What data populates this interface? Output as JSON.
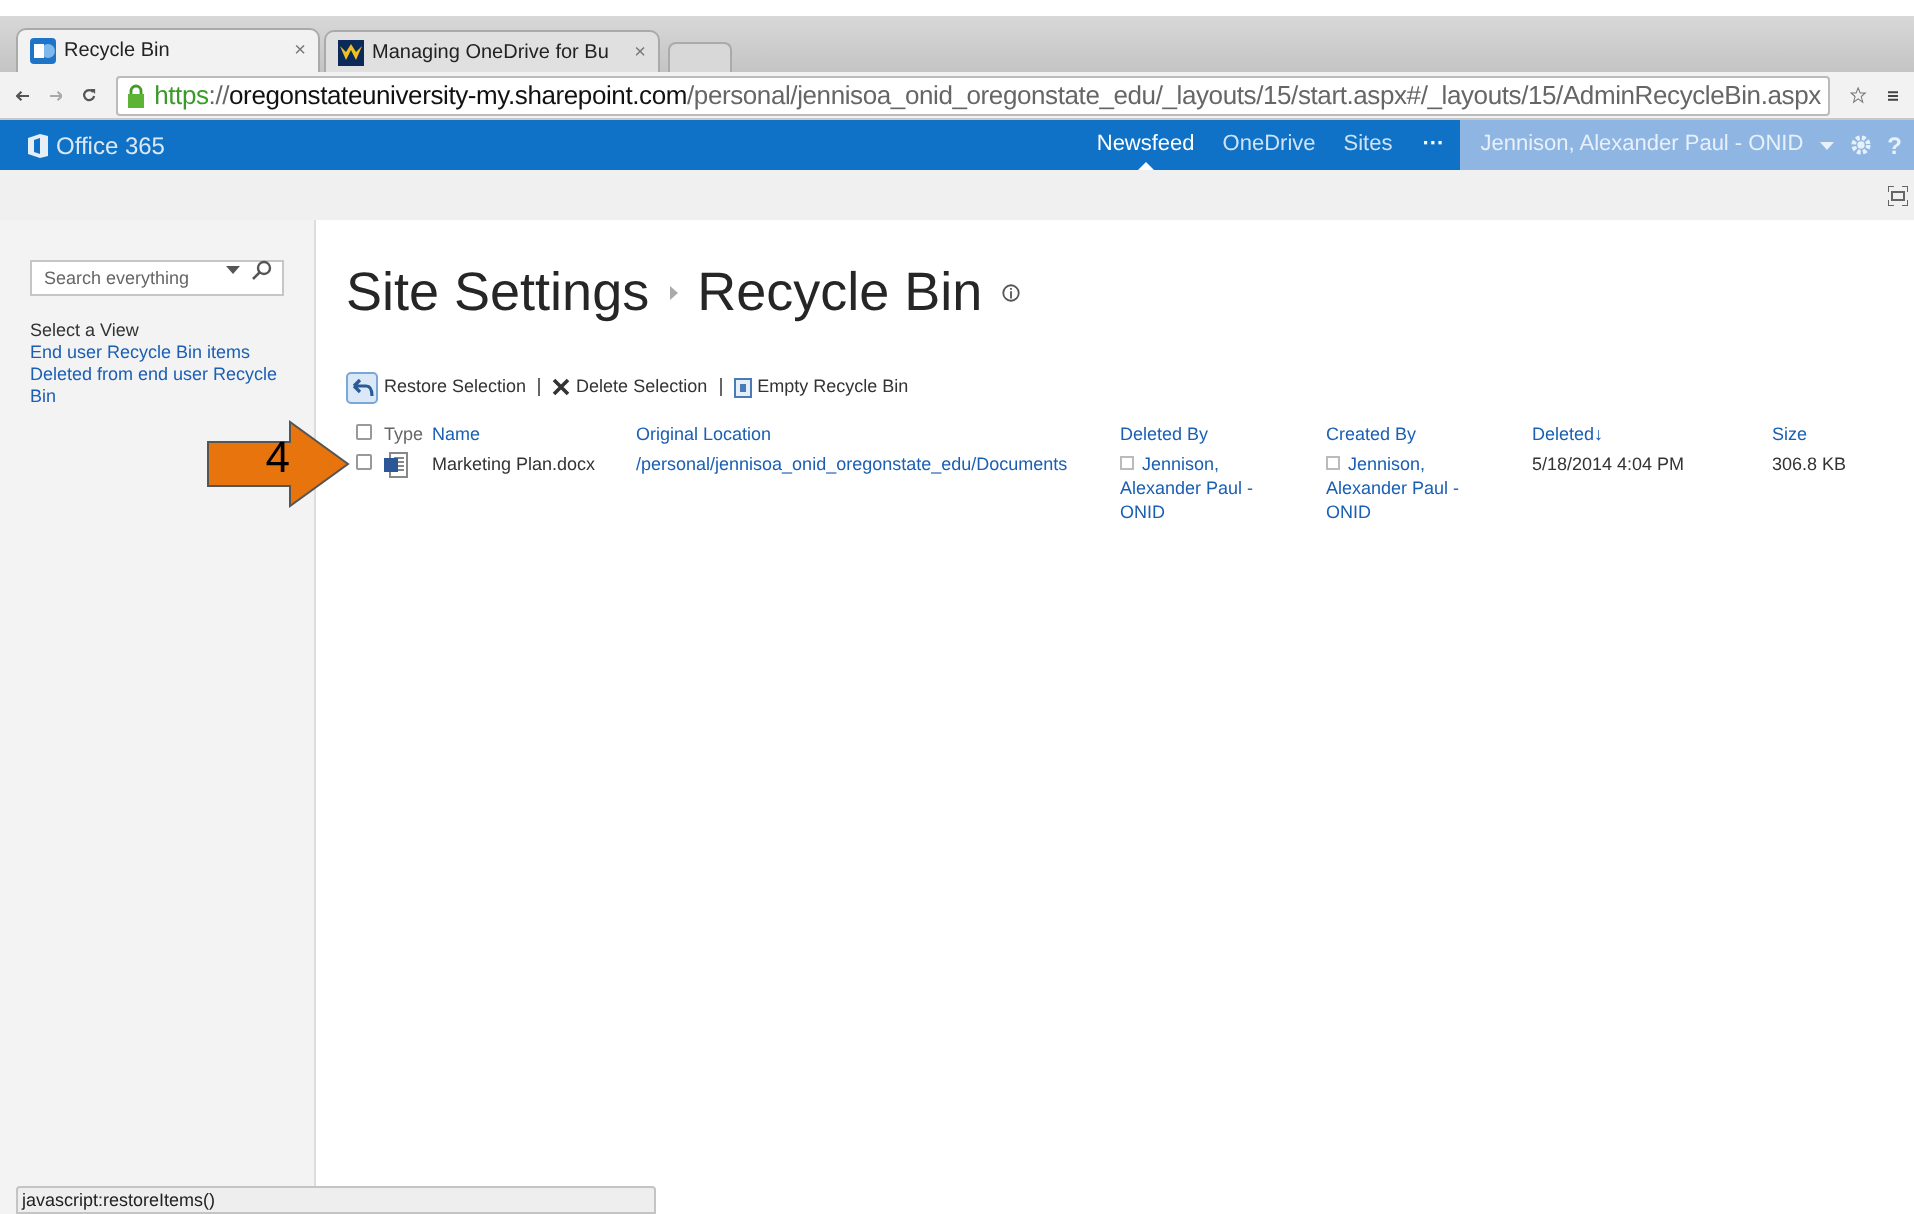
{
  "browser": {
    "tabs": [
      {
        "title": "Recycle Bin",
        "close": "×",
        "selected": true
      },
      {
        "title": "Managing OneDrive for Bu",
        "close": "×",
        "selected": false
      }
    ],
    "url_parts": [
      {
        "kind": "scheme",
        "text": "https"
      },
      {
        "kind": "dim",
        "text": "://"
      },
      {
        "kind": "host",
        "text": "oregonstateuniversity-my.sharepoint.com"
      },
      {
        "kind": "dim",
        "text": "/personal/jennisoa_onid_oregonstate_edu/_layouts/15/start.aspx#/_layouts/15/AdminRecycleBin.aspx"
      }
    ],
    "status_text": "javascript:restoreItems()"
  },
  "suite_bar": {
    "brand": "Office 365",
    "links": [
      {
        "label": "Newsfeed",
        "selected": true
      },
      {
        "label": "OneDrive",
        "selected": false
      },
      {
        "label": "Sites",
        "selected": false
      }
    ],
    "more": "···",
    "user": "Jennison, Alexander Paul - ONID",
    "help": "?"
  },
  "sidebar": {
    "search": {
      "placeholder": "Search everything"
    },
    "heading": "Select a View",
    "items": [
      {
        "label": "End user Recycle Bin items"
      },
      {
        "label": "Deleted from end user Recycle Bin"
      }
    ]
  },
  "page": {
    "breadcrumb": [
      "Site Settings",
      "Recycle Bin"
    ],
    "actions": [
      {
        "label": "Restore Selection",
        "kind": "restore"
      },
      {
        "label": "Delete Selection",
        "kind": "delete"
      },
      {
        "label": "Empty Recycle Bin",
        "kind": "empty"
      }
    ],
    "table": {
      "select_all_checked": false,
      "columns": [
        "Type",
        "Name",
        "Original Location",
        "Deleted By",
        "Created By",
        "Deleted↓",
        "Size"
      ],
      "rows": [
        {
          "checked": false,
          "name": "Marketing Plan.docx",
          "location": "/personal/jennisoa_onid_oregonstate_edu/Documents",
          "deleted_by": "Jennison, Alexander Paul - ONID",
          "created_by": "Jennison, Alexander Paul - ONID",
          "deleted": "5/18/2014 4:04 PM",
          "size": "306.8 KB"
        }
      ]
    }
  },
  "callout": {
    "label": "4"
  }
}
